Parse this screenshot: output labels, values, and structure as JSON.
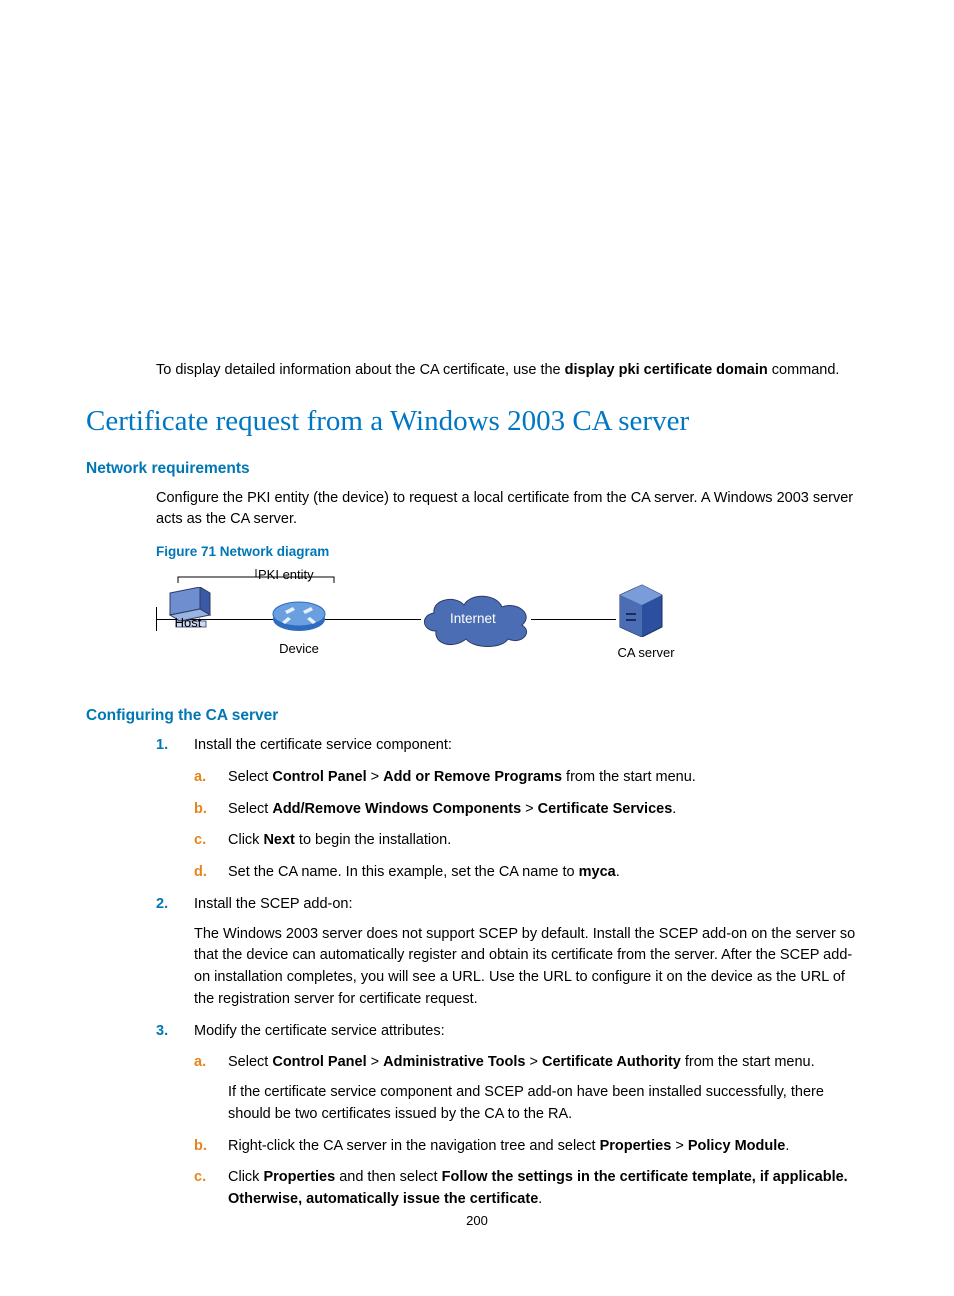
{
  "intro_prefix": "To display detailed information about the CA certificate, use the ",
  "intro_cmd": "display pki certificate domain",
  "intro_suffix": " command.",
  "title": "Certificate request from a Windows 2003 CA server",
  "h_req": "Network requirements",
  "req_body": "Configure the PKI entity (the device) to request a local certificate from the CA server. A Windows 2003 server acts as the CA server.",
  "fig_caption": "Figure 71 Network diagram",
  "diagram": {
    "pki_entity": "PKI entity",
    "host": "Host",
    "device": "Device",
    "internet": "Internet",
    "ca_server": "CA server"
  },
  "h_cfg": "Configuring the CA server",
  "s1_text": "Install the certificate service component:",
  "s1a_pre": "Select ",
  "s1a_b1": "Control Panel",
  "s1a_gt1": " > ",
  "s1a_b2": "Add or Remove Programs",
  "s1a_post": " from the start menu.",
  "s1b_pre": "Select ",
  "s1b_b1": "Add/Remove Windows Components",
  "s1b_gt": " > ",
  "s1b_b2": "Certificate Services",
  "s1b_post": ".",
  "s1c_pre": "Click ",
  "s1c_b": "Next",
  "s1c_post": " to begin the installation.",
  "s1d_pre": "Set the CA name. In this example, set the CA name to ",
  "s1d_b": "myca",
  "s1d_post": ".",
  "s2_text": "Install the SCEP add-on:",
  "s2_body": "The Windows 2003 server does not support SCEP by default. Install the SCEP add-on on the server so that the device can automatically register and obtain its certificate from the server. After the SCEP add-on installation completes, you will see a URL. Use the URL to configure it on the device as the URL of the registration server for certificate request.",
  "s3_text": "Modify the certificate service attributes:",
  "s3a_pre": "Select ",
  "s3a_b1": "Control Panel",
  "s3a_gt1": " > ",
  "s3a_b2": "Administrative Tools",
  "s3a_gt2": " > ",
  "s3a_b3": "Certificate Authority",
  "s3a_post": " from the start menu.",
  "s3a_body": "If the certificate service component and SCEP add-on have been installed successfully, there should be two certificates issued by the CA to the RA.",
  "s3b_pre": "Right-click the CA server in the navigation tree and select ",
  "s3b_b1": "Properties",
  "s3b_gt": " > ",
  "s3b_b2": "Policy Module",
  "s3b_post": ".",
  "s3c_pre": "Click ",
  "s3c_b1": "Properties",
  "s3c_mid": " and then select ",
  "s3c_b2": "Follow the settings in the certificate template, if applicable. Otherwise, automatically issue the certificate",
  "s3c_post": ".",
  "page_num": "200"
}
